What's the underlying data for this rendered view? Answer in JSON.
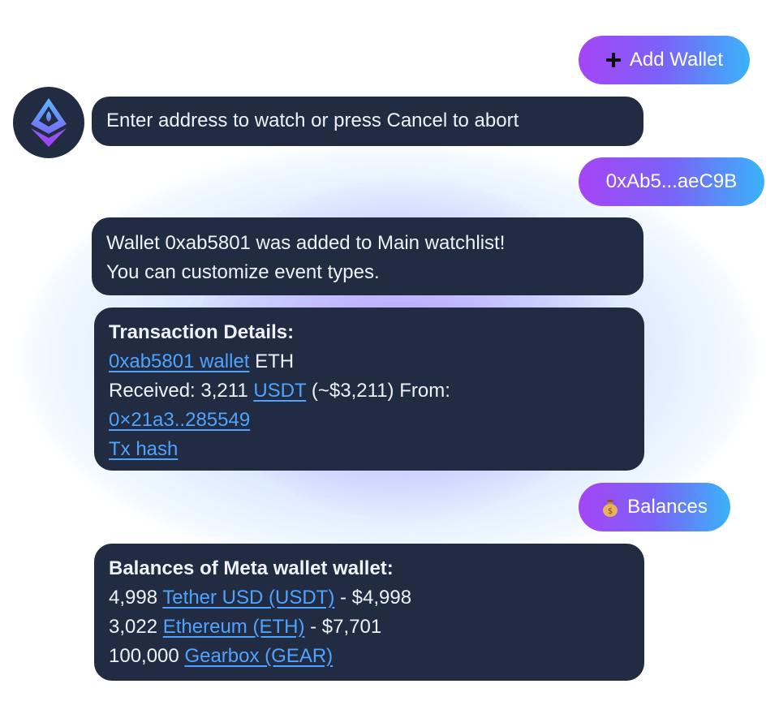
{
  "buttons": {
    "add_wallet": {
      "icon": "plus-icon",
      "label": "Add Wallet"
    },
    "address": {
      "label": "0xAb5...aeC9B"
    },
    "balances": {
      "icon": "money-bag-icon",
      "label": "Balances"
    }
  },
  "bot": {
    "avatar_icon": "ethereum-logo-icon"
  },
  "messages": {
    "prompt": "Enter address to watch or press Cancel to abort",
    "added_line1": "Wallet 0xab5801 was added to Main watchlist!",
    "added_line2": "You can customize event types.",
    "tx": {
      "title": "Transaction Details:",
      "wallet_link": "0xab5801 wallet",
      "chain": "ETH",
      "received_prefix": "Received: 3,211",
      "token_link": "USDT",
      "received_suffix": "(~$3,211) From:",
      "from_link": "0×21a3..285549",
      "hash_link": "Tx hash"
    },
    "balances": {
      "title": "Balances of Meta wallet wallet:",
      "items": [
        {
          "amount": "4,998",
          "token": "Tether USD (USDT)",
          "value": "- $4,998"
        },
        {
          "amount": "3,022",
          "token": "Ethereum (ETH)",
          "value": "- $7,701"
        },
        {
          "amount": "100,000",
          "token": "Gearbox (GEAR)",
          "value": ""
        }
      ]
    }
  },
  "colors": {
    "bubble_bg": "#212c42",
    "link": "#4fa3ff",
    "gradient_start": "#a545f5",
    "gradient_end": "#3ab3f9"
  }
}
